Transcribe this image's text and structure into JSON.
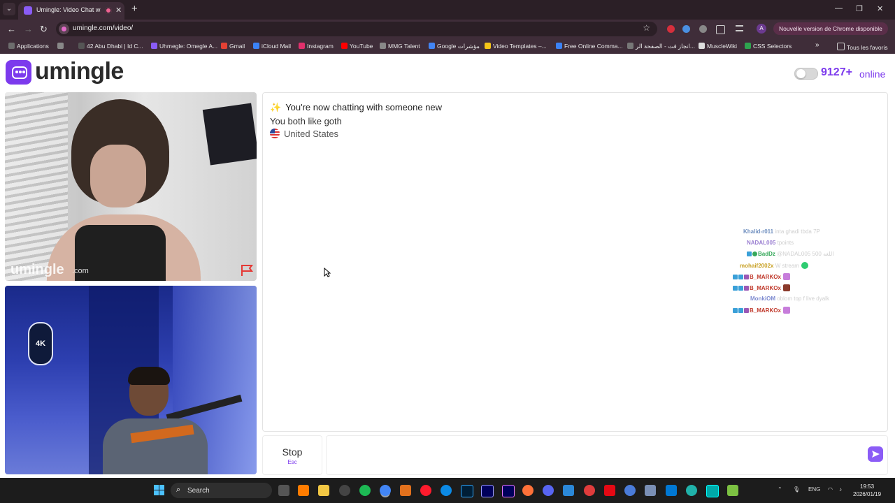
{
  "browser": {
    "tab_title": "Umingle: Video Chat with S",
    "url": "umingle.com/video/",
    "profile_initial": "A",
    "update_label": "Nouvelle version de Chrome disponible"
  },
  "bookmarks": {
    "items": [
      {
        "label": "Applications",
        "color": "#6d6d6d"
      },
      {
        "label": "42 Abu Dhabi | Id C...",
        "color": "#555555"
      },
      {
        "label": "Uhmegle: Omegle A...",
        "color": "#8a5cf6"
      },
      {
        "label": "Gmail",
        "color": "#e44134"
      },
      {
        "label": "iCloud Mail",
        "color": "#3b82f6"
      },
      {
        "label": "Instagram",
        "color": "#e1306c"
      },
      {
        "label": "YouTube",
        "color": "#ff0000"
      },
      {
        "label": "MMG Talent",
        "color": "#888888"
      },
      {
        "label": "Google مؤشرات",
        "color": "#4285f4"
      },
      {
        "label": "Video Templates –...",
        "color": "#f5c518"
      },
      {
        "label": "Free Online Comma...",
        "color": "#3b82f6"
      },
      {
        "label": "انجاز فت - الصفحة الر...",
        "color": "#777777"
      },
      {
        "label": "MuscleWiki",
        "color": "#dddddd"
      },
      {
        "label": "CSS Selectors",
        "color": "#2ea44f"
      }
    ],
    "all_favs": "Tous les favoris"
  },
  "site": {
    "logo_text": "umingle",
    "online_count": "9127+",
    "online_label": "online",
    "brand_color": "#7c3aed"
  },
  "remote_video": {
    "watermark": "umingle",
    "watermark_suffix": ".com"
  },
  "local_video": {
    "badge": "4K"
  },
  "chat": {
    "system_message": "You're now chatting with someone new",
    "interest": "You both like goth",
    "country": "United States"
  },
  "overlay_chat": [
    {
      "user": "Khalid-r011",
      "text": "inta ghadi tbda 7P",
      "user_color": "#6f8fbf"
    },
    {
      "user": "NADAL005",
      "text": "tpoints",
      "user_color": "#9b7fd1"
    },
    {
      "user": "BadDz",
      "text": "@NADAL005 500 اللغه",
      "user_color": "#36a85a"
    },
    {
      "user": "mohaif2002x",
      "text": "W stream",
      "user_color": "#c9a227"
    },
    {
      "user": "B_MARKOx",
      "text": "",
      "user_color": "#c0392b"
    },
    {
      "user": "B_MARKOx",
      "text": "",
      "user_color": "#c0392b"
    },
    {
      "user": "MonkiOM",
      "text": "oblom top f live dyalk",
      "user_color": "#7e8bd0"
    },
    {
      "user": "B_MARKOx",
      "text": "",
      "user_color": "#c0392b"
    }
  ],
  "controls": {
    "stop_label": "Stop",
    "stop_hint": "Esc",
    "message_placeholder": ""
  },
  "taskbar": {
    "search_label": "Search",
    "lang": "ENG",
    "time": "19:53",
    "date": "2026/01/19"
  }
}
